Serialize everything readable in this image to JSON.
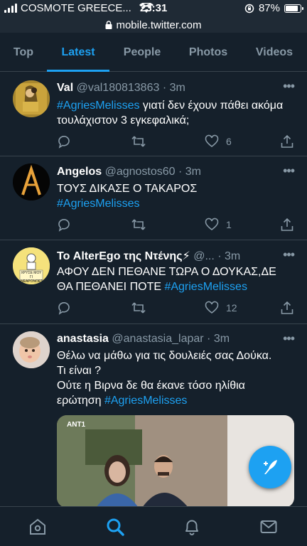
{
  "status": {
    "carrier": "COSMOTE GREECE...",
    "time": "23:31",
    "battery": "87%",
    "battery_level": 0.87,
    "url": "mobile.twitter.com"
  },
  "tabs": [
    {
      "label": "Top"
    },
    {
      "label": "Latest"
    },
    {
      "label": "People"
    },
    {
      "label": "Photos"
    },
    {
      "label": "Videos"
    }
  ],
  "tweets": [
    {
      "name": "Val",
      "meta": "@val180813863 · 3m",
      "text_hashtag": "#AgriesMelisses",
      "text": "  γιατί δεν έχουν πάθει ακόμα τουλάχιστον 3 εγκεφαλικά;",
      "likes": "6"
    },
    {
      "name": "Angelos",
      "meta": "@agnostos60 · 3m",
      "text": "ΤΟΥΣ ΔΙΚΑΣΕ Ο ΤΑΚΑΡΟΣ",
      "text_hashtag": "#AgriesMelisses",
      "likes": "1"
    },
    {
      "name": "Το AlterEgo της Ντένης⚡",
      "meta": "@... · 3m",
      "text": "ΑΦΟΥ ΔΕΝ ΠΕΘΑΝΕ ΤΩΡΑ Ο ΔΟΥΚΑΣ,ΔΕ ΘΑ ΠΕΘΑΝΕΙ ΠΟΤΕ ",
      "text_hashtag": "#AgriesMelisses",
      "likes": "12",
      "avatar_text": "ΧΡΥΣΕ ΜΟΥ ΓΙ ΝΕΑΡΟΝΟΕΣ"
    },
    {
      "name": "anastasia",
      "meta": "@anastasia_lapar · 3m",
      "line1": "Θέλω να μάθω για τις δουλειές σας Δούκα.",
      "line2": "Τι είναι ?",
      "line3": "Ούτε η Βιρνα δε θα έκανε τόσο ηλίθια",
      "line4": "ερώτηση  ",
      "text_hashtag": "#AgriesMelisses"
    }
  ],
  "colors": {
    "background": "#15202b",
    "accent": "#1da1f2",
    "secondary_text": "#8899a6",
    "divider": "#38444d"
  }
}
